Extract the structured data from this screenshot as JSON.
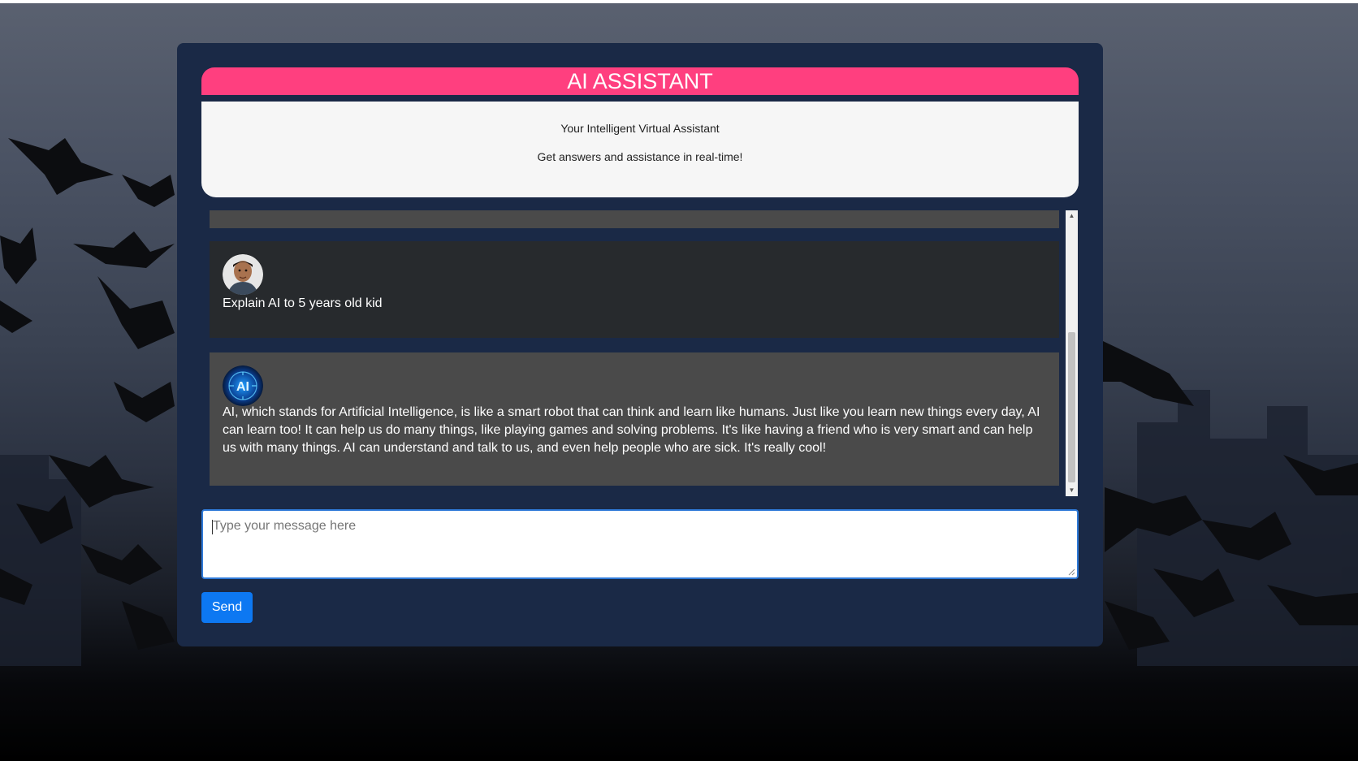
{
  "app": {
    "title": "AI ASSISTANT",
    "subtitle": "Your Intelligent Virtual Assistant",
    "tagline": "Get answers and assistance in real-time!"
  },
  "chat": {
    "messages": [
      {
        "role": "user",
        "avatar": "user-avatar",
        "text": "Explain AI to 5 years old kid"
      },
      {
        "role": "assistant",
        "avatar": "ai-avatar",
        "avatar_label": "AI",
        "text": "AI, which stands for Artificial Intelligence, is like a smart robot that can think and learn like humans. Just like you learn new things every day, AI can learn too! It can help us do many things, like playing games and solving problems. It's like having a friend who is very smart and can help us with many things. AI can understand and talk to us, and even help people who are sick. It's really cool!"
      }
    ]
  },
  "composer": {
    "placeholder": "Type your message here",
    "send_label": "Send"
  },
  "colors": {
    "header": "#ff3f7f",
    "card": "#1a2946",
    "send_button": "#0d78f2",
    "user_message_bg": "#272a2d",
    "ai_message_bg": "#4a4a4a"
  }
}
